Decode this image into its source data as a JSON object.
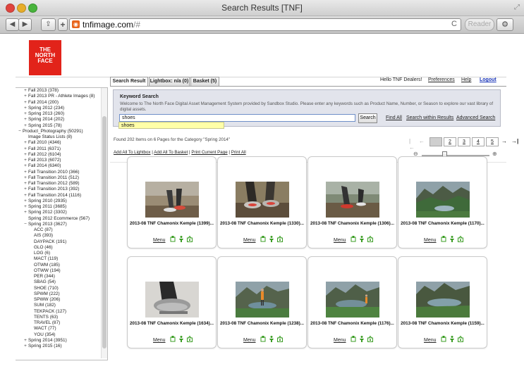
{
  "window": {
    "title": "Search Results [TNF]"
  },
  "browser": {
    "url_host": "tnfimage.com",
    "url_rest": "/#",
    "reader_label": "Reader",
    "reload_glyph": "C",
    "settings_glyph": "⚙",
    "back_glyph": "◀",
    "forward_glyph": "▶",
    "share_glyph": "⇪",
    "add_glyph": "+"
  },
  "logo": {
    "lines": [
      "THE",
      "NORTH",
      "FACE"
    ]
  },
  "sidebar": {
    "items": [
      {
        "t": "+",
        "label": "Fall 2013 (378)",
        "indent": 1
      },
      {
        "t": "+",
        "label": "Fall 2013 PR - Athlete Images (8)",
        "indent": 1
      },
      {
        "t": "+",
        "label": "Fall 2014 (200)",
        "indent": 1
      },
      {
        "t": "+",
        "label": "Spring 2012 (234)",
        "indent": 1
      },
      {
        "t": "+",
        "label": "Spring 2013 (260)",
        "indent": 1
      },
      {
        "t": "+",
        "label": "Spring 2014 (202)",
        "indent": 1
      },
      {
        "t": "+",
        "label": "Spring 2015 (78)",
        "indent": 1
      },
      {
        "t": "−",
        "label": "Product_Photography (50291)",
        "indent": 0
      },
      {
        "t": "",
        "label": "Image Status Lists (8)",
        "indent": 1
      },
      {
        "t": "+",
        "label": "Fall 2010 (4346)",
        "indent": 1
      },
      {
        "t": "+",
        "label": "Fall 2011 (6371)",
        "indent": 1
      },
      {
        "t": "+",
        "label": "Fall 2012 (6104)",
        "indent": 1
      },
      {
        "t": "+",
        "label": "Fall 2013 (6072)",
        "indent": 1
      },
      {
        "t": "+",
        "label": "Fall 2014 (6340)",
        "indent": 1
      },
      {
        "t": "+",
        "label": "Fall Transition 2010 (366)",
        "indent": 1
      },
      {
        "t": "+",
        "label": "Fall Transition 2011 (512)",
        "indent": 1
      },
      {
        "t": "+",
        "label": "Fall Transition 2012 (589)",
        "indent": 1
      },
      {
        "t": "+",
        "label": "Fall Transition 2013 (392)",
        "indent": 1
      },
      {
        "t": "+",
        "label": "Fall Transition 2014 (1116)",
        "indent": 1
      },
      {
        "t": "+",
        "label": "Spring 2010 (2935)",
        "indent": 1
      },
      {
        "t": "+",
        "label": "Spring 2011 (3685)",
        "indent": 1
      },
      {
        "t": "+",
        "label": "Spring 2012 (3302)",
        "indent": 1
      },
      {
        "t": "",
        "label": "Spring 2012 Ecommerce (567)",
        "indent": 1
      },
      {
        "t": "−",
        "label": "Spring 2013 (3627)",
        "indent": 1
      },
      {
        "t": "",
        "label": "ACC (87)",
        "indent": 2
      },
      {
        "t": "",
        "label": "AIS (393)",
        "indent": 2
      },
      {
        "t": "",
        "label": "DAYPACK (191)",
        "indent": 2
      },
      {
        "t": "",
        "label": "GLO (46)",
        "indent": 2
      },
      {
        "t": "",
        "label": "LOG (6)",
        "indent": 2
      },
      {
        "t": "",
        "label": "MACT (119)",
        "indent": 2
      },
      {
        "t": "",
        "label": "OTWM (185)",
        "indent": 2
      },
      {
        "t": "",
        "label": "OTWW (194)",
        "indent": 2
      },
      {
        "t": "",
        "label": "PER (344)",
        "indent": 2
      },
      {
        "t": "",
        "label": "SBAG (54)",
        "indent": 2
      },
      {
        "t": "",
        "label": "SHOE (710)",
        "indent": 2
      },
      {
        "t": "",
        "label": "SPWM (222)",
        "indent": 2
      },
      {
        "t": "",
        "label": "SPWW (206)",
        "indent": 2
      },
      {
        "t": "",
        "label": "SUM (182)",
        "indent": 2
      },
      {
        "t": "",
        "label": "TEKPACK (127)",
        "indent": 2
      },
      {
        "t": "",
        "label": "TENTS (63)",
        "indent": 2
      },
      {
        "t": "",
        "label": "TRAVEL (87)",
        "indent": 2
      },
      {
        "t": "",
        "label": "WACT (77)",
        "indent": 2
      },
      {
        "t": "",
        "label": "YOU (354)",
        "indent": 2
      },
      {
        "t": "+",
        "label": "Spring 2014 (3951)",
        "indent": 1
      },
      {
        "t": "+",
        "label": "Spring 2015 (16)",
        "indent": 1
      }
    ]
  },
  "tabs": {
    "search_result": "Search Result",
    "lightbox": "Lightbox: n/a (0)",
    "basket": "Basket (5)"
  },
  "header": {
    "greeting": "Hello TNF Dealers!",
    "preferences": "Preferences",
    "help": "Help",
    "logout": "Logout"
  },
  "keyword_search": {
    "title": "Keyword Search",
    "description": "Welcome to The North Face Digital Asset Management System provided by Sandbox Studio. Please enter any keywords such as Product Name, Number, or Season to explore our vast library of digital assets.",
    "input_value": "shoes",
    "search_button": "Search",
    "find_all": "Find All",
    "search_within": "Search within Results",
    "advanced": "Advanced Search",
    "suggestion": "shoes"
  },
  "results": {
    "found_text": "Found 202 Items on 6 Pages for the Category \"Spring 2014\"",
    "pages": [
      "1",
      "2",
      "3",
      "4",
      "5"
    ],
    "current_page": "1",
    "first_glyph": "|←",
    "prev_glyph": "←",
    "next_glyph": "→",
    "last_glyph": "→|"
  },
  "actions": {
    "add_lightbox": "Add All To Lightbox",
    "add_basket": "Add All To Basket",
    "print_page": "Print Current Page",
    "print_all": "Print All",
    "sep": "|"
  },
  "zoom": {
    "minus_glyph": "⊖",
    "plus_glyph": "⊕",
    "level": 0.33
  },
  "cards": [
    {
      "title": "2013-08 TNF Chamonix Kemple (1399)...",
      "menu": "Menu",
      "scene": "runner"
    },
    {
      "title": "2013-08 TNF Chamonix Kemple (1330)...",
      "menu": "Menu",
      "scene": "shoes"
    },
    {
      "title": "2013-08 TNF Chamonix Kemple (1306)...",
      "menu": "Menu",
      "scene": "runner2"
    },
    {
      "title": "2013-08 TNF Chamonix Kemple (1170)...",
      "menu": "Menu",
      "scene": "valley"
    },
    {
      "title": "2013-08 TNF Chamonix Kemple (1634)...",
      "menu": "Menu",
      "scene": "shoe-closeup"
    },
    {
      "title": "2013-08 TNF Chamonix Kemple (1238)...",
      "menu": "Menu",
      "scene": "runner-lake"
    },
    {
      "title": "2013-08 TNF Chamonix Kemple (1176)...",
      "menu": "Menu",
      "scene": "lake-runner"
    },
    {
      "title": "2013-08 TNF Chamonix Kemple (1159)...",
      "menu": "Menu",
      "scene": "lake"
    }
  ],
  "colors": {
    "brand_red": "#e2231a",
    "icon_green": "#3a9d23",
    "logout_blue": "#1a35b8"
  }
}
